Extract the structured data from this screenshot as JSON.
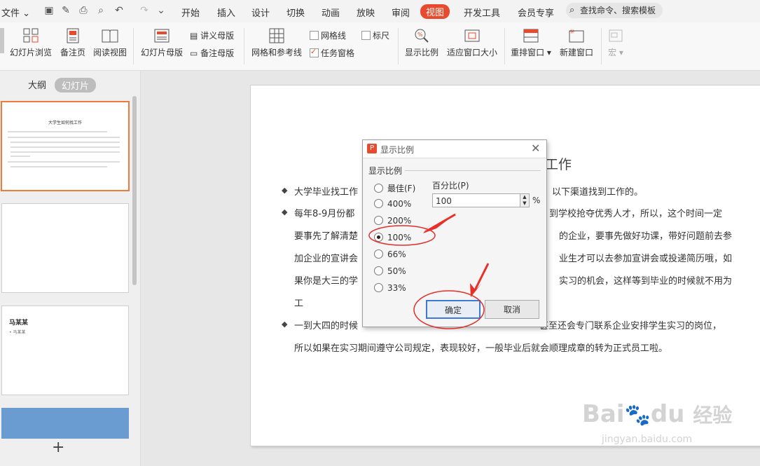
{
  "menubar": {
    "file_label": "文件",
    "tabs": [
      "开始",
      "插入",
      "设计",
      "切换",
      "动画",
      "放映",
      "审阅",
      "视图",
      "开发工具",
      "会员专享"
    ],
    "active_tab": "视图",
    "search_placeholder": "查找命令、搜索模板"
  },
  "ribbon": {
    "slide_browse": "幻灯片浏览",
    "notes_page": "备注页",
    "reading_view": "阅读视图",
    "slide_master": "幻灯片母版",
    "handout_master": "讲义母版",
    "notes_master": "备注母版",
    "grid_guides": "网格和参考线",
    "gridlines": "网格线",
    "ruler": "标尺",
    "task_pane": "任务窗格",
    "zoom": "显示比例",
    "fit_window": "适应窗口大小",
    "arrange_windows": "重排窗口",
    "new_window": "新建窗口",
    "macro": "宏"
  },
  "leftpane": {
    "tab_outline": "大纲",
    "tab_slides": "幻灯片",
    "thumb1_title": "大学生如何找工作",
    "thumb3_title": "马某某",
    "thumb3_sub": "• 马某某",
    "add_label": "+"
  },
  "slide": {
    "title_partial": "工作",
    "line1_left": "大学毕业找工作",
    "line1_right": "以下渠道找到工作的。",
    "line2_left": "每年8-9月份都",
    "line2_right": "到学校抢夺优秀人才，所以，这个时间一定",
    "line3_left": "要事先了解清楚",
    "line3_right": "的企业，要事先做好功课，带好问题前去参",
    "line4_left": "加企业的宣讲会",
    "line4_right": "业生才可以去参加宣讲会或投递简历哦，如",
    "line5_left": "果你是大三的学",
    "line5_right": "实习的机会，这样等到毕业的时候就不用为",
    "line6": "工",
    "line7_left": "一到大四的时候",
    "line7_right": "甚至还会专门联系企业安排学生实习的岗位，",
    "line8": "所以如果在实习期间遵守公司规定，表现较好，一般毕业后就会顺理成章的转为正式员工啦。"
  },
  "dialog": {
    "logo": "P",
    "title": "显示比例",
    "close": "✕",
    "group_label": "显示比例",
    "options": [
      "最佳(F)",
      "400%",
      "200%",
      "100%",
      "66%",
      "50%",
      "33%"
    ],
    "selected": "100%",
    "percent_label": "百分比(P)",
    "percent_value": "100",
    "percent_sign": "%",
    "ok": "确定",
    "cancel": "取消"
  },
  "watermark": {
    "brand": "Bai du 经验",
    "url": "jingyan.baidu.com"
  }
}
